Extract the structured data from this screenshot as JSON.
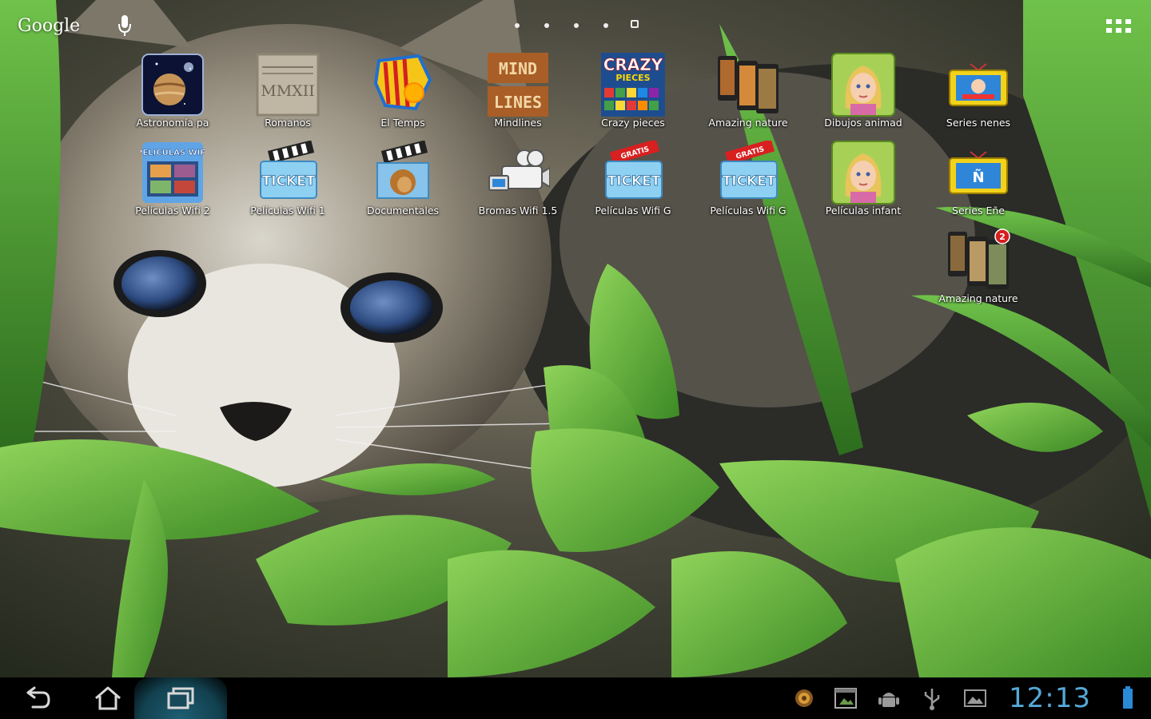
{
  "top_bar": {
    "google_label": "Google",
    "voice_icon": "microphone-icon",
    "all_apps_icon": "apps-grid-icon",
    "page_count": 5,
    "current_page": 5
  },
  "apps": [
    {
      "label": "Astronomía pa",
      "icon": "planet-icon"
    },
    {
      "label": "Romanos",
      "icon": "roman-stone-icon",
      "art_text": "MMXII"
    },
    {
      "label": "El Temps",
      "icon": "catalonia-sun-icon"
    },
    {
      "label": "Mindlines",
      "icon": "mind-lines-icon",
      "art_text_top": "MIND",
      "art_text_bottom": "LINES"
    },
    {
      "label": "Crazy pieces",
      "icon": "crazy-pieces-icon",
      "art_text_top": "CRAZY",
      "art_text_bottom": "PIECES"
    },
    {
      "label": "Amazing nature",
      "icon": "phones-nature-icon"
    },
    {
      "label": "Dibujos animad",
      "icon": "cartoon-girl-icon"
    },
    {
      "label": "Series nenes",
      "icon": "tv-kids-icon"
    },
    {
      "label": "Películas Wifi 2",
      "icon": "movies-wifi-icon",
      "art_text": "PELICULAS WIFI"
    },
    {
      "label": "Películas Wifi 1",
      "icon": "ticket-icon",
      "art_text": "TICKET"
    },
    {
      "label": "Documentales",
      "icon": "lion-film-icon"
    },
    {
      "label": "Bromas Wifi 1.5",
      "icon": "camera-icon"
    },
    {
      "label": "Películas Wifi G",
      "icon": "ticket-gratis-icon",
      "art_text": "TICKET",
      "badge_text": "GRATIS"
    },
    {
      "label": "Películas Wifi G",
      "icon": "ticket-gratis-icon",
      "art_text": "TICKET",
      "badge_text": "GRATIS"
    },
    {
      "label": "Películas infant",
      "icon": "cartoon-girl-icon"
    },
    {
      "label": "Series Eñe",
      "icon": "tv-enye-icon",
      "art_text": "Ñ"
    },
    {
      "label": "Amazing nature",
      "icon": "phones-nature-icon",
      "badge": "2"
    }
  ],
  "navbar": {
    "back_icon": "back-icon",
    "home_icon": "home-icon",
    "recent_icon": "recent-apps-icon",
    "status_icons": [
      "notification-app-icon",
      "screenshot-icon",
      "android-debug-icon",
      "usb-icon",
      "gallery-icon"
    ],
    "time": "12:13",
    "battery_icon": "battery-icon"
  },
  "colors": {
    "clock": "#55a8d6",
    "navbar": "#000000",
    "recent_highlight": "#1f5e73"
  }
}
